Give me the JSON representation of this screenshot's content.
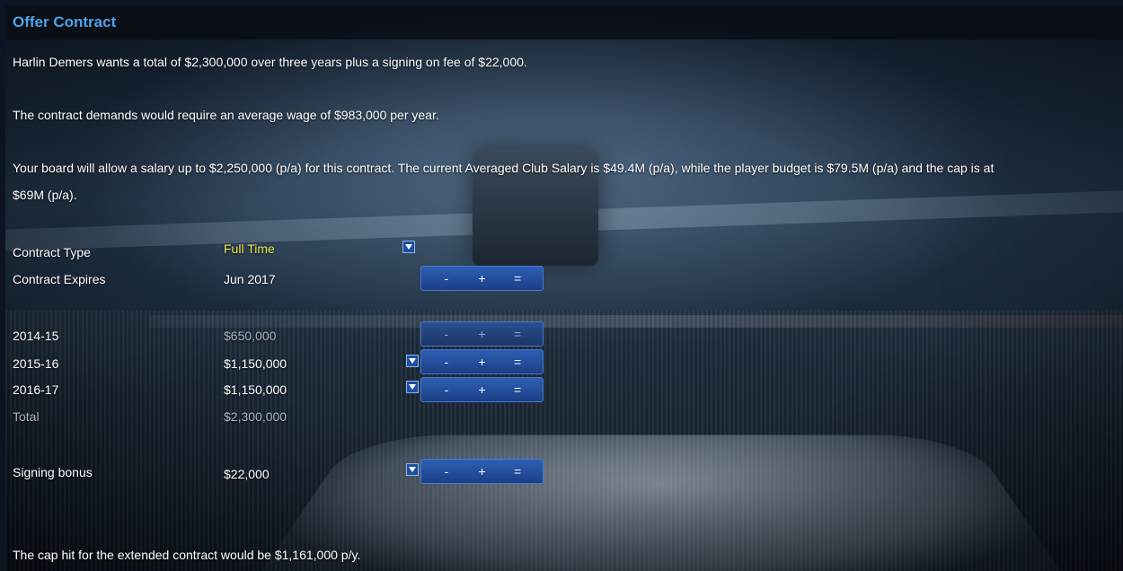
{
  "title": "Offer Contract",
  "paragraphs": {
    "p1": "Harlin Demers wants a total of $2,300,000 over three years plus a signing on fee of $22,000.",
    "p2": "The contract demands would require an average wage of $983,000 per year.",
    "p3_line1": "Your board will allow a salary up to $2,250,000 (p/a) for this contract. The current Averaged Club Salary is $49.4M (p/a), while the player budget is $79.5M (p/a) and the cap is at",
    "p3_line2": "$69M (p/a).",
    "footer": "The cap hit for the extended contract would be $1,161,000 p/y."
  },
  "contract_type": {
    "label": "Contract Type",
    "value": "Full Time"
  },
  "contract_expires": {
    "label": "Contract Expires",
    "value": "Jun 2017"
  },
  "salary_rows": [
    {
      "season": "2014-15",
      "amount": "$650,000"
    },
    {
      "season": "2015-16",
      "amount": "$1,150,000"
    },
    {
      "season": "2016-17",
      "amount": "$1,150,000"
    }
  ],
  "total": {
    "label": "Total",
    "value": "$2,300,000"
  },
  "signing_bonus": {
    "label": "Signing bonus",
    "value": "$22,000"
  },
  "stepper": {
    "minus": "-",
    "plus": "+",
    "equals": "="
  },
  "colors": {
    "title": "#4fa3e6",
    "contract_type_value": "#e6e64a",
    "button": "#2d5fb5"
  }
}
